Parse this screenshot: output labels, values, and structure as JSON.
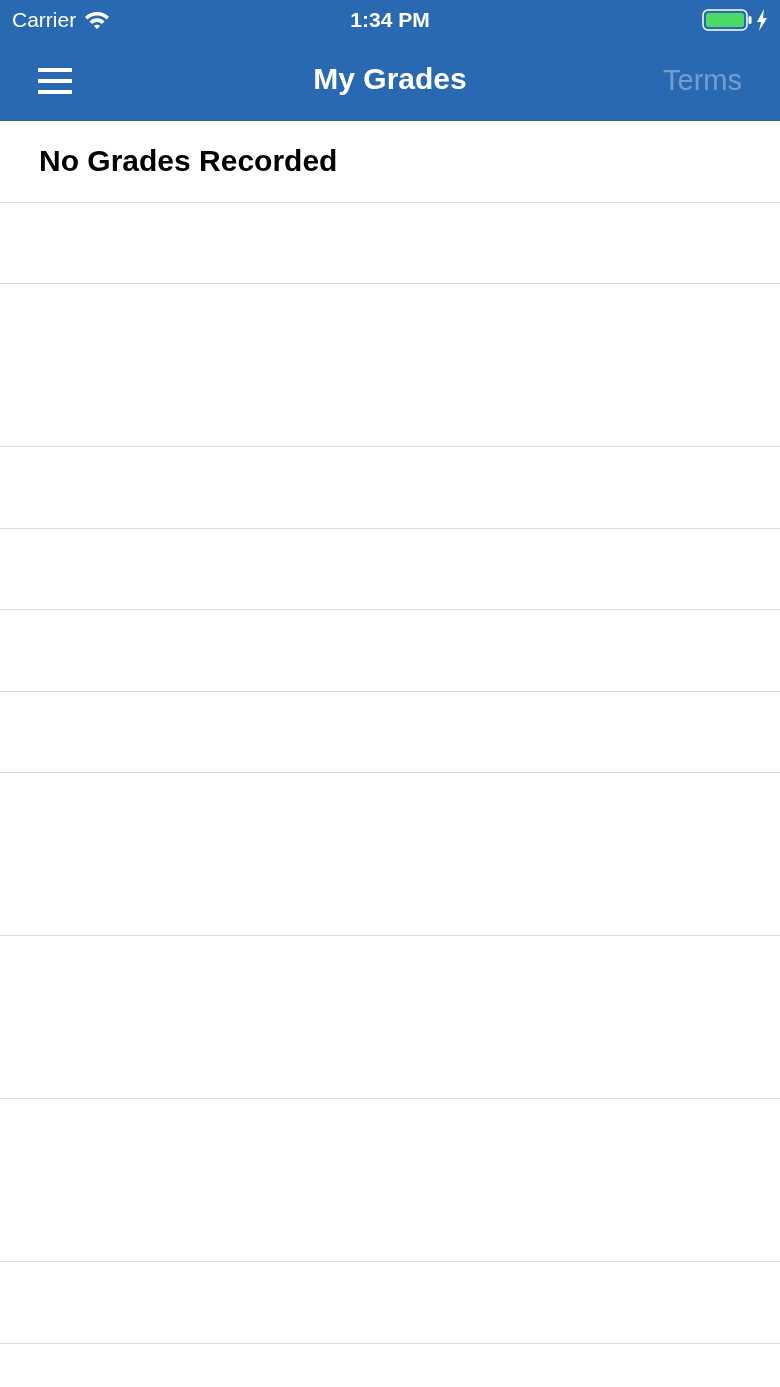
{
  "status_bar": {
    "carrier": "Carrier",
    "time": "1:34 PM"
  },
  "nav_bar": {
    "title": "My Grades",
    "right_button": {
      "label": "Terms",
      "disabled": true
    }
  },
  "list": {
    "rows": [
      {
        "title": "No Grades Recorded"
      }
    ]
  }
}
